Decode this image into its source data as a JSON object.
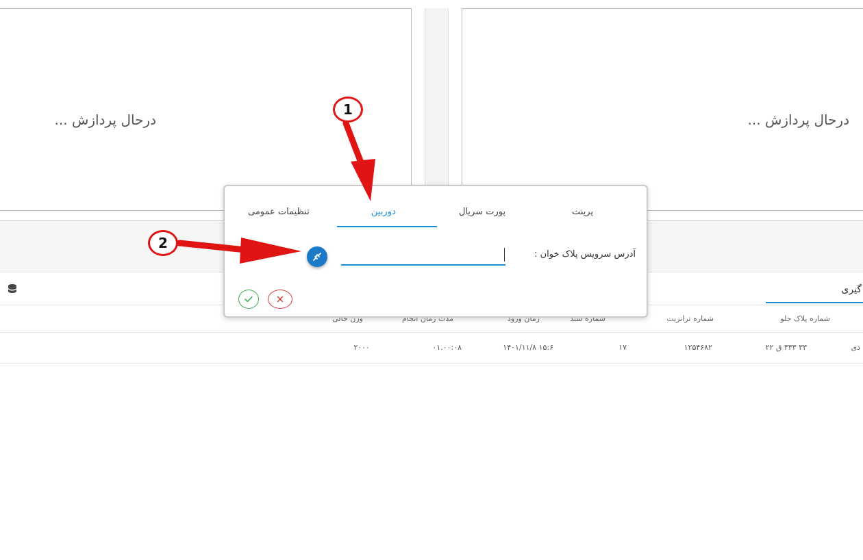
{
  "camera_panels": {
    "left": {
      "status_text": "درحال پردازش ..."
    },
    "right": {
      "status_text": "درحال پردازش ..."
    }
  },
  "lower_section": {
    "tab_partial_label": "گیری",
    "columns": [
      "شماره پلاک جلو",
      "شماره ترانزیت",
      "شماره سند",
      "زمان ورود",
      "مدت زمان انجام",
      "وزن خالی"
    ],
    "rows": [
      {
        "plate_front": "۳۳ ۳۳۳ ق ۲۲",
        "transit_number": "۱۲۵۴۶۸۲",
        "document_number": "۱۷",
        "entry_time": "۱۵:۶ ۱۴۰۱/۱۱/۸",
        "duration": "۰۱.۰۰:۰۸",
        "empty_weight": "۲۰۰۰",
        "partial_first_cell": "دی"
      }
    ]
  },
  "dialog": {
    "tabs": [
      {
        "label": "تنظیمات عمومی",
        "active": false
      },
      {
        "label": "دوربین",
        "active": true
      },
      {
        "label": "پورت سریال",
        "active": false
      },
      {
        "label": "پرینت",
        "active": false
      }
    ],
    "field_label": "آدرس سرویس پلاک خوان :",
    "field_value": "",
    "buttons": {
      "test_connection_icon": "plug-icon",
      "ok_icon": "check-icon",
      "cancel_icon": "close-icon"
    },
    "accent_color": "#1a8fd6"
  },
  "annotations": {
    "marker_1": "1",
    "marker_2": "2",
    "color": "#e11414"
  }
}
